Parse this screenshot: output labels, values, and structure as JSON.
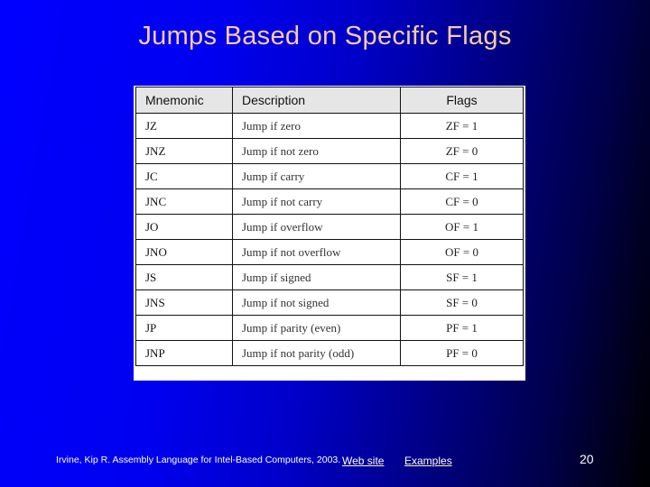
{
  "slide": {
    "title": "Jumps Based on Specific Flags",
    "page_number": "20"
  },
  "table": {
    "headers": [
      "Mnemonic",
      "Description",
      "Flags"
    ],
    "rows": [
      {
        "mnemonic": "JZ",
        "description": "Jump if zero",
        "flags": "ZF = 1"
      },
      {
        "mnemonic": "JNZ",
        "description": "Jump if not zero",
        "flags": "ZF = 0"
      },
      {
        "mnemonic": "JC",
        "description": "Jump if carry",
        "flags": "CF = 1"
      },
      {
        "mnemonic": "JNC",
        "description": "Jump if not carry",
        "flags": "CF = 0"
      },
      {
        "mnemonic": "JO",
        "description": "Jump if overflow",
        "flags": "OF = 1"
      },
      {
        "mnemonic": "JNO",
        "description": "Jump if not overflow",
        "flags": "OF = 0"
      },
      {
        "mnemonic": "JS",
        "description": "Jump if signed",
        "flags": "SF = 1"
      },
      {
        "mnemonic": "JNS",
        "description": "Jump if not signed",
        "flags": "SF = 0"
      },
      {
        "mnemonic": "JP",
        "description": "Jump if parity (even)",
        "flags": "PF = 1"
      },
      {
        "mnemonic": "JNP",
        "description": "Jump if not parity (odd)",
        "flags": "PF = 0"
      }
    ]
  },
  "footer": {
    "citation": "Irvine, Kip R. Assembly Language for Intel-Based Computers, 2003.",
    "links": [
      "Web site",
      "Examples"
    ]
  },
  "colors": {
    "title": "#f5cda0",
    "background_start": "#0000ff",
    "background_end": "#000000",
    "link_underline": "#ffff80"
  }
}
